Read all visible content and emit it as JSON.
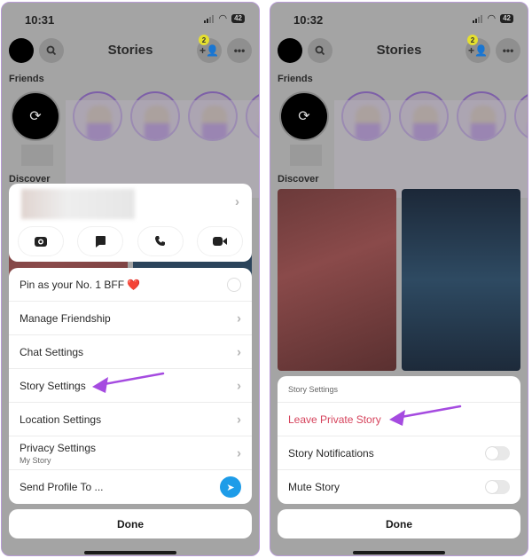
{
  "screens": [
    {
      "status": {
        "time": "10:31",
        "battery": "42"
      },
      "header": {
        "title": "Stories",
        "add_friend_badge": "2"
      },
      "sections": {
        "friends": "Friends",
        "discover": "Discover"
      },
      "action_buttons": [
        "camera-icon",
        "chat-icon",
        "phone-icon",
        "video-icon"
      ],
      "menu": [
        {
          "label": "Pin as your No. 1 BFF ❤️",
          "control": "radio"
        },
        {
          "label": "Manage Friendship",
          "control": "chevron"
        },
        {
          "label": "Chat Settings",
          "control": "chevron"
        },
        {
          "label": "Story Settings",
          "control": "chevron",
          "highlighted": true
        },
        {
          "label": "Location Settings",
          "control": "chevron"
        },
        {
          "label": "Privacy Settings",
          "sublabel": "My Story",
          "control": "chevron"
        },
        {
          "label": "Send Profile To ...",
          "control": "send"
        }
      ],
      "done_label": "Done"
    },
    {
      "status": {
        "time": "10:32",
        "battery": "42"
      },
      "header": {
        "title": "Stories",
        "add_friend_badge": "2"
      },
      "sections": {
        "friends": "Friends",
        "discover": "Discover"
      },
      "sheet": {
        "header": "Story Settings",
        "items": [
          {
            "label": "Leave Private Story",
            "style": "destructive",
            "highlighted": true
          },
          {
            "label": "Story Notifications",
            "control": "toggle",
            "value": false
          },
          {
            "label": "Mute Story",
            "control": "toggle",
            "value": false
          }
        ]
      },
      "done_label": "Done"
    }
  ],
  "colors": {
    "annotation_arrow": "#a54be0",
    "destructive": "#d6435c",
    "send_button": "#1e9ce8",
    "badge": "#e5e02e"
  },
  "icons": {
    "chevron": "›",
    "more": "•••",
    "add_friend": "+👤",
    "search": "🔍",
    "refresh": "⟳",
    "send": "➤"
  }
}
